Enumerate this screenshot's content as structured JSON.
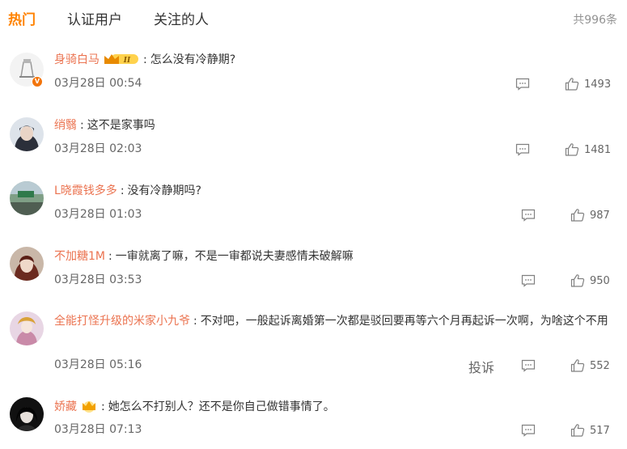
{
  "tabs": {
    "hot": "热门",
    "verified": "认证用户",
    "following": "关注的人"
  },
  "total": "共996条",
  "report_label": "投诉",
  "colors": {
    "accent": "#ff8200",
    "username": "#eb7350"
  },
  "comments": [
    {
      "user": "身骑白马",
      "text": "怎么没有冷静期?",
      "time": "03月28日 00:54",
      "likes": "1493"
    },
    {
      "user": "绡翳",
      "text": "这不是家事吗",
      "time": "03月28日 02:03",
      "likes": "1481"
    },
    {
      "user": "L晓霞钱多多",
      "text": "没有冷静期吗?",
      "time": "03月28日 01:03",
      "likes": "987"
    },
    {
      "user": "不加糖1M",
      "text": "一审就离了嘛，不是一审都说夫妻感情未破解嘛",
      "time": "03月28日 03:53",
      "likes": "950"
    },
    {
      "user": "全能打怪升级的米家小九爷",
      "text": "不对吧，一般起诉离婚第一次都是驳回要再等六个月再起诉一次啊，为啥这个不用",
      "time": "03月28日 05:16",
      "likes": "552"
    },
    {
      "user": "娇藏",
      "text": "她怎么不打别人？还不是你自己做错事情了。",
      "time": "03月28日 07:13",
      "likes": "517"
    }
  ]
}
